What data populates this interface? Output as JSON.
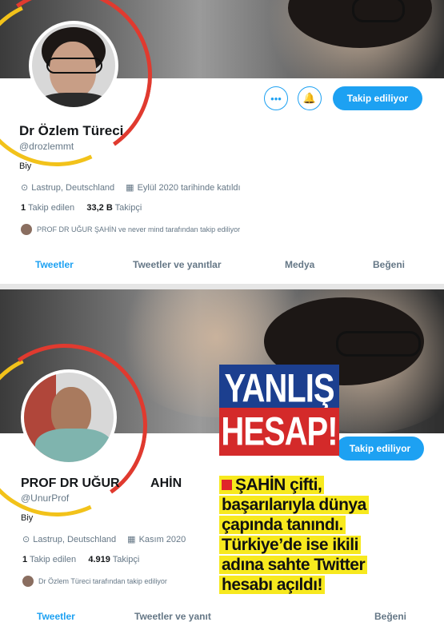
{
  "profile1": {
    "name": "Dr Özlem Türeci",
    "handle": "@drozlemmt",
    "bio": "Biy",
    "location": "Lastrup, Deutschland",
    "joined": "Eylül 2020 tarihinde katıldı",
    "following_count": "1",
    "following_label": "Takip edilen",
    "followers_count": "33,2 B",
    "followers_label": "Takipçi",
    "followed_by": "PROF DR UĞUR ŞAHİN ve never mind tarafından takip ediliyor",
    "follow_button": "Takip ediliyor",
    "more_icon": "•••",
    "bell_icon": "🔔",
    "tabs": [
      "Tweetler",
      "Tweetler ve yanıtlar",
      "Medya",
      "Beğeni"
    ]
  },
  "profile2": {
    "name": "PROF DR UĞUR ŞAHİN",
    "name_visible": "PROF DR UĞUR",
    "name_tail": "AHİN",
    "handle": "@UnurProf",
    "bio": "Biy",
    "location": "Lastrup, Deutschland",
    "joined": "Kasım 2020",
    "following_count": "1",
    "following_label": "Takip edilen",
    "followers_count": "4.919",
    "followers_label": "Takipçi",
    "followed_by": "Dr Özlem Türeci tarafından takip ediliyor",
    "follow_button": "Takip ediliyor",
    "tabs": [
      "Tweetler",
      "Tweetler ve yanıt",
      "Beğeni"
    ]
  },
  "overlay": {
    "headline_1": "YANLIŞ",
    "headline_2": "HESAP!",
    "lines": [
      "ŞAHİN çifti,",
      "başarılarıyla dünya",
      "çapında tanındı.",
      "Türkiye’de ise ikili",
      "adına sahte Twitter",
      "hesabı açıldı!"
    ]
  },
  "colors": {
    "twitter_blue": "#1da1f2",
    "ring_red": "#e03a2f",
    "ring_yellow": "#f2c21a",
    "headline_blue": "#1c3f8f",
    "headline_red": "#d42a2a",
    "highlight_yellow": "#f7e91e"
  },
  "icons": {
    "location": "location-pin-icon",
    "calendar": "calendar-icon",
    "more": "more-options-icon",
    "bell": "notification-bell-icon"
  }
}
